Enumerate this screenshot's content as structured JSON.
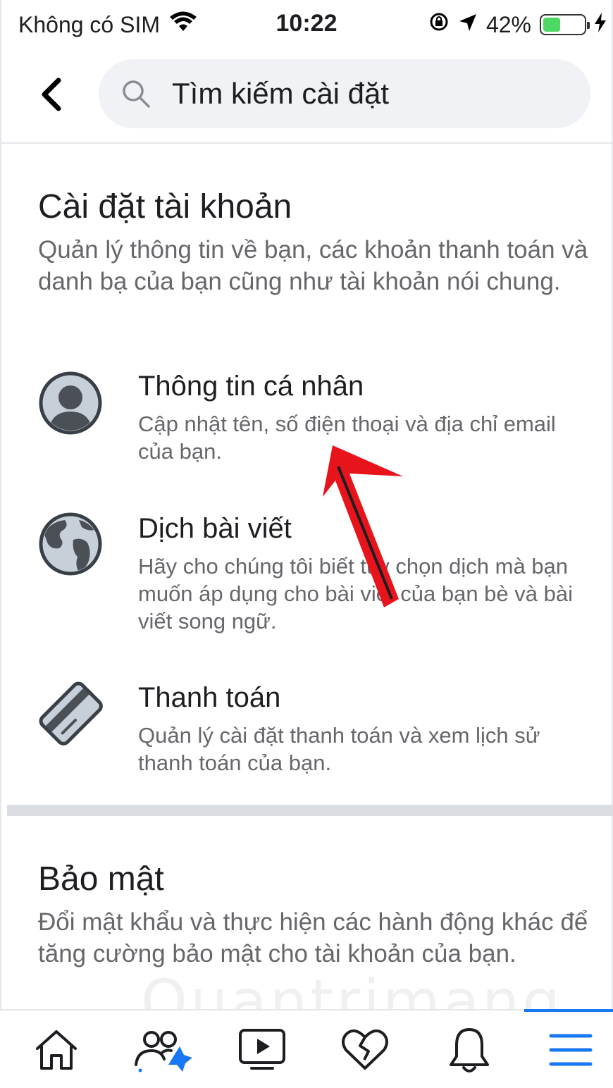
{
  "status_bar": {
    "carrier": "Không có SIM",
    "time": "10:22",
    "battery_percent": "42%",
    "battery_level": 0.42
  },
  "header": {
    "search_placeholder": "Tìm kiếm cài đặt"
  },
  "account_section": {
    "title": "Cài đặt tài khoản",
    "description": "Quản lý thông tin về bạn, các khoản thanh toán và danh bạ của bạn cũng như tài khoản nói chung.",
    "items": [
      {
        "title": "Thông tin cá nhân",
        "description": "Cập nhật tên, số điện thoại và địa chỉ email của bạn.",
        "icon": "profile-icon"
      },
      {
        "title": "Dịch bài viết",
        "description": "Hãy cho chúng tôi biết tùy chọn dịch mà bạn muốn áp dụng cho bài viết của bạn bè và bài viết song ngữ.",
        "icon": "globe-icon"
      },
      {
        "title": "Thanh toán",
        "description": "Quản lý cài đặt thanh toán và xem lịch sử thanh toán của bạn.",
        "icon": "credit-card-icon"
      }
    ]
  },
  "security_section": {
    "title": "Bảo mật",
    "description": "Đổi mật khẩu và thực hiện các hành động khác để tăng cường bảo mật cho tài khoản của bạn."
  },
  "watermark": "Quantrimang",
  "tab_bar": {
    "tabs": [
      {
        "icon": "home-icon"
      },
      {
        "icon": "friends-icon"
      },
      {
        "icon": "watch-icon"
      },
      {
        "icon": "dating-heart-icon"
      },
      {
        "icon": "notifications-bell-icon"
      },
      {
        "icon": "menu-icon",
        "active": true
      }
    ]
  },
  "colors": {
    "accent": "#1877f2",
    "annotation_arrow": "#e8141b",
    "text_primary": "#1c1e21",
    "text_secondary": "#65676b",
    "search_bg": "#f0f2f5"
  }
}
